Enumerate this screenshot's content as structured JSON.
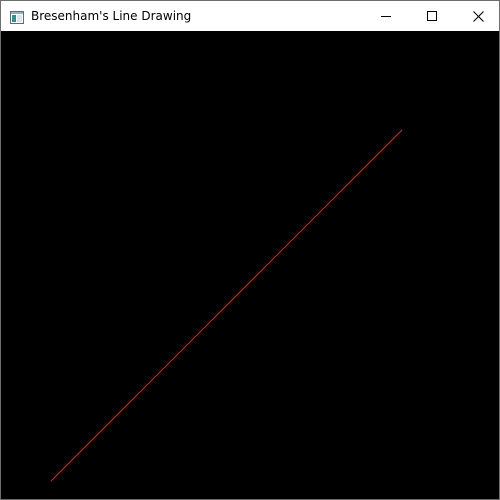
{
  "window": {
    "title": "Bresenham's Line Drawing",
    "controls": {
      "minimize_icon": "minimize-icon",
      "maximize_icon": "maximize-icon",
      "close_icon": "close-icon"
    }
  },
  "canvas": {
    "background": "#000000",
    "line": {
      "color": "#c8331e"
    }
  }
}
